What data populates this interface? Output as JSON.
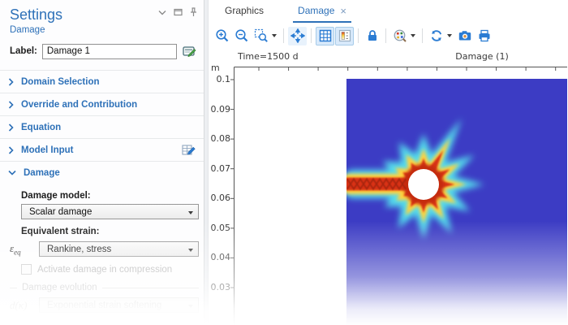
{
  "settings_panel": {
    "title": "Settings",
    "subtitle": "Damage",
    "window_icons": [
      "chevron-down-icon",
      "float-window-icon",
      "pin-icon"
    ],
    "label_field": {
      "label": "Label:",
      "value": "Damage 1"
    },
    "sections": [
      {
        "label": "Domain Selection",
        "state": "collapsed"
      },
      {
        "label": "Override and Contribution",
        "state": "collapsed"
      },
      {
        "label": "Equation",
        "state": "collapsed"
      },
      {
        "label": "Model Input",
        "state": "collapsed",
        "edit_icon": true
      },
      {
        "label": "Damage",
        "state": "expanded"
      }
    ],
    "damage_section": {
      "damage_model_label": "Damage model:",
      "damage_model_value": "Scalar damage",
      "equivalent_strain_label": "Equivalent strain:",
      "equivalent_strain_symbol": "ε",
      "equivalent_strain_symbol_sub": "eq",
      "equivalent_strain_value": "Rankine, stress",
      "compression_checkbox_label": "Activate damage in compression",
      "compression_checkbox_checked": false,
      "damage_evolution_group_label": "Damage evolution",
      "damage_evolution_symbol": "d(κ)",
      "damage_evolution_value": "Exponential strain softening"
    }
  },
  "graphics_panel": {
    "tabs": [
      {
        "label": "Graphics",
        "active": false
      },
      {
        "label": "Damage",
        "active": true,
        "close": "×"
      }
    ],
    "toolbar_icons": [
      "zoom-in",
      "zoom-out",
      "zoom-box",
      "zoom-extents",
      "grid",
      "color-legend",
      "lock",
      "color-palette",
      "refresh",
      "snapshot-camera",
      "print"
    ],
    "toolbar_toggled_on": [
      "grid",
      "color-legend"
    ],
    "plot": {
      "time_label": "Time=1500 d",
      "title": "Damage (1)",
      "y_axis_unit": "m",
      "y_ticks": [
        "0.1",
        "0.09",
        "0.08",
        "0.07",
        "0.06",
        "0.05",
        "0.04",
        "0.03"
      ],
      "field_description": "damage field: blue domain with red crack band and starburst damage zone around circular hole at y=0.065 m"
    }
  },
  "colors": {
    "accent_blue": "#2E71B8",
    "toolbar_icon_blue": "#2B7CD3",
    "plot_domain_blue": "#3C3CC4",
    "crack_red": "#D83018",
    "crack_yellow": "#FFD23C",
    "halo_cyan": "#55DCEC",
    "disabled_gray": "#B8B8B8"
  }
}
